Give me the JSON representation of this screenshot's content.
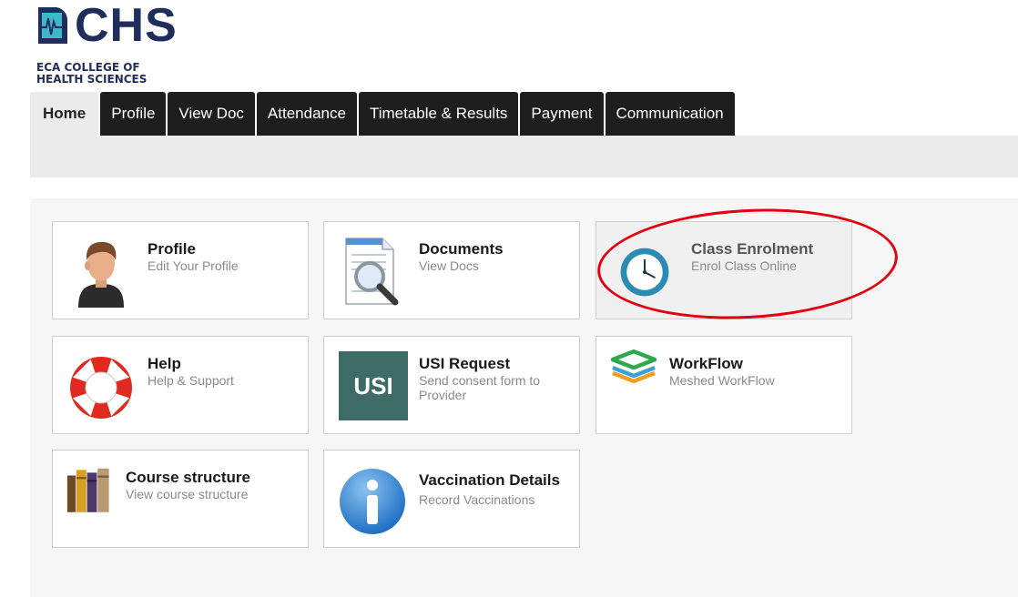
{
  "logo": {
    "word": "CHS",
    "subtitle": "ECA COLLEGE OF\nHEALTH SCIENCES",
    "colors": {
      "primary": "#1f2d5c",
      "accent": "#3cb8c8"
    }
  },
  "tabs": [
    {
      "label": "Home",
      "active": true
    },
    {
      "label": "Profile"
    },
    {
      "label": "View Doc"
    },
    {
      "label": "Attendance"
    },
    {
      "label": "Timetable & Results"
    },
    {
      "label": "Payment"
    },
    {
      "label": "Communication"
    }
  ],
  "tiles": {
    "profile": {
      "title": "Profile",
      "subtitle": "Edit Your Profile",
      "icon": "user-avatar-icon"
    },
    "documents": {
      "title": "Documents",
      "subtitle": "View Docs",
      "icon": "document-search-icon"
    },
    "class_enrolment": {
      "title": "Class Enrolment",
      "subtitle": "Enrol Class Online",
      "icon": "clock-icon",
      "highlighted": true
    },
    "help": {
      "title": "Help",
      "subtitle": "Help & Support",
      "icon": "lifebuoy-icon"
    },
    "usi_request": {
      "title": "USI Request",
      "subtitle": "Send consent form to Provider",
      "icon": "usi-badge-icon",
      "badge_text": "USI"
    },
    "workflow": {
      "title": "WorkFlow",
      "subtitle": "Meshed WorkFlow",
      "icon": "layers-icon"
    },
    "course_structure": {
      "title": "Course structure",
      "subtitle": "View course structure",
      "icon": "books-icon"
    },
    "vaccination": {
      "title": "Vaccination Details",
      "subtitle": "Record Vaccinations",
      "icon": "info-icon"
    }
  },
  "colors": {
    "tab_bg": "#1e1e1e",
    "tab_active_bg": "#ebebeb",
    "highlight_ring": "#e3000f",
    "usi_badge": "#3d6b66"
  }
}
